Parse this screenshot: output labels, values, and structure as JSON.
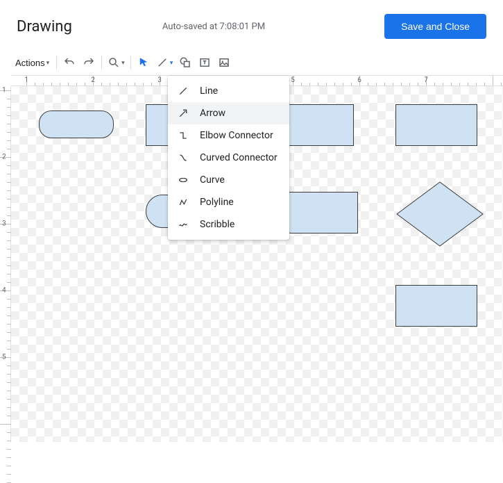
{
  "header": {
    "title": "Drawing",
    "autosave": "Auto-saved at 7:08:01 PM",
    "save_label": "Save and Close"
  },
  "toolbar": {
    "actions_label": "Actions"
  },
  "ruler_h": {
    "labels": [
      "1",
      "2",
      "3",
      "4",
      "5",
      "6",
      "7"
    ]
  },
  "ruler_v": {
    "labels": [
      "1",
      "2",
      "3",
      "4",
      "5"
    ]
  },
  "line_menu": {
    "items": [
      {
        "label": "Line"
      },
      {
        "label": "Arrow"
      },
      {
        "label": "Elbow Connector"
      },
      {
        "label": "Curved Connector"
      },
      {
        "label": "Curve"
      },
      {
        "label": "Polyline"
      },
      {
        "label": "Scribble"
      }
    ],
    "hovered_index": 1
  }
}
